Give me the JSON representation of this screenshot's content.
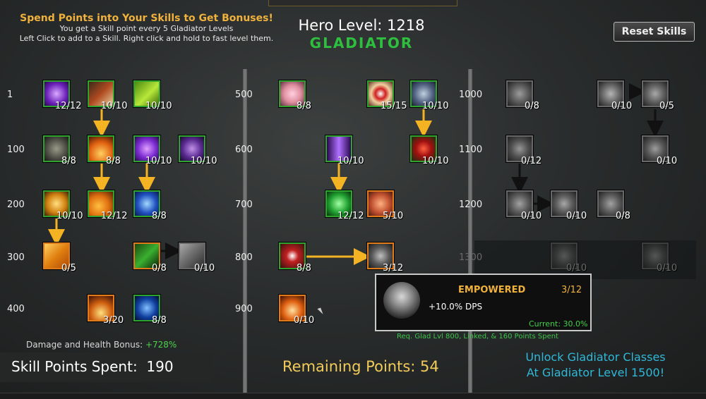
{
  "header": {
    "intro_title": "Spend Points into Your Skills to Get Bonuses!",
    "intro_line1": "You get a Skill point every 5 Gladiator Levels",
    "intro_line2": "Left Click to add to a Skill. Right click and hold to fast level them.",
    "hero_level": "Hero Level: 1218",
    "class_name": "GLADIATOR",
    "reset_label": "Reset Skills"
  },
  "level_labels": [
    "1",
    "100",
    "200",
    "300",
    "400",
    "500",
    "600",
    "700",
    "800",
    "900",
    "1000",
    "1100",
    "1200",
    "1300"
  ],
  "skill_counts": {
    "c1r1a": "12/12",
    "c1r1b": "10/10",
    "c1r1c": "10/10",
    "c1r2a": "8/8",
    "c1r2b": "8/8",
    "c1r2c": "10/10",
    "c1r2d": "10/10",
    "c1r3a": "10/10",
    "c1r3b": "12/12",
    "c1r3c": "8/8",
    "c1r4a": "0/5",
    "c1r4b": "0/8",
    "c1r4c": "0/10",
    "c1r5a": "3/20",
    "c1r5b": "8/8",
    "c2r1a": "8/8",
    "c2r1b": "15/15",
    "c2r1c": "10/10",
    "c2r2a": "10/10",
    "c2r2b": "10/10",
    "c2r3a": "12/12",
    "c2r3b": "5/10",
    "c2r4a": "8/8",
    "c2r4b": "3/12",
    "c2r5a": "0/10",
    "c3r1a": "0/8",
    "c3r1b": "0/10",
    "c3r1c": "0/5",
    "c3r2a": "0/12",
    "c3r2b": "0/10",
    "c3r3a": "0/10",
    "c3r3b": "0/10",
    "c3r3c": "0/8",
    "c3r4a": "0/10",
    "c3r4b": "0/10"
  },
  "tooltip": {
    "name": "EMPOWERED",
    "rank": "3/12",
    "bonus": "+10.0% DPS",
    "current": "Current: 30.0%",
    "requirement": "Req. Glad Lvl 800, Linked, & 160 Points Spent"
  },
  "footer": {
    "damage_label": "Damage and Health Bonus:",
    "damage_value": "+728%",
    "points_spent": "Skill Points Spent:  190",
    "remaining": "Remaining Points: 54",
    "unlock_line1": "Unlock Gladiator Classes",
    "unlock_line2": "At Gladiator Level 1500!"
  },
  "colors": {
    "gold": "#f0b23c",
    "unlocked_border": "#2ea42e",
    "locked_border": "#e07b1c",
    "arrow_gold": "#f4b323",
    "class_green": "#2fbf3e",
    "unlock_cyan": "#30b8d8"
  }
}
